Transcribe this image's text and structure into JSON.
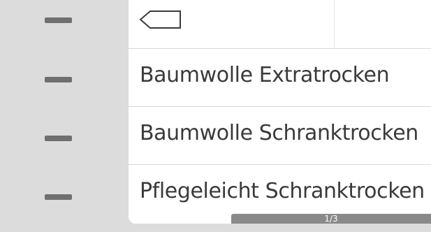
{
  "colors": {
    "background": "#dcdcdc",
    "panel": "#ffffff",
    "marker": "#6f6f6f",
    "text": "#3a3a3a",
    "divider": "#d6d6d6",
    "pager": "#8a8a8a"
  },
  "header": {
    "back_icon": "back-arrow-tag-icon"
  },
  "programs": [
    {
      "label": "Baumwolle Extratrocken"
    },
    {
      "label": "Baumwolle Schranktrocken"
    },
    {
      "label": "Pflegeleicht Schranktrocken"
    }
  ],
  "pager": {
    "label": "1/3",
    "current": 1,
    "total": 3
  }
}
